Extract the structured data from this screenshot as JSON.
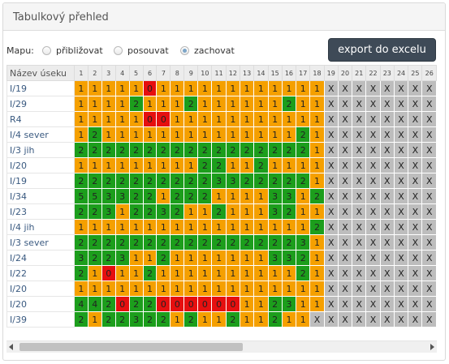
{
  "panel": {
    "title": "Tabulkový přehled"
  },
  "map": {
    "label": "Mapu:",
    "options": [
      {
        "label": "přibližovat",
        "selected": false
      },
      {
        "label": "posouvat",
        "selected": false
      },
      {
        "label": "zachovat",
        "selected": true
      }
    ]
  },
  "export_label": "export do excelu",
  "table": {
    "name_header": "Název úseku",
    "columns": [
      "1",
      "2",
      "3",
      "4",
      "5",
      "6",
      "7",
      "8",
      "9",
      "10",
      "11",
      "12",
      "13",
      "14",
      "15",
      "16",
      "17",
      "18",
      "19",
      "20",
      "21",
      "22",
      "23",
      "24",
      "25",
      "26"
    ],
    "rows": [
      {
        "name": "I/19",
        "cells": [
          "1",
          "1",
          "1",
          "1",
          "1",
          "0",
          "1",
          "1",
          "1",
          "1",
          "1",
          "1",
          "1",
          "1",
          "1",
          "1",
          "1",
          "1",
          "X",
          "X",
          "X",
          "X",
          "X",
          "X",
          "X",
          "X"
        ]
      },
      {
        "name": "I/29",
        "cells": [
          "1",
          "1",
          "1",
          "1",
          "2",
          "1",
          "1",
          "1",
          "2",
          "1",
          "1",
          "1",
          "1",
          "1",
          "1",
          "2",
          "1",
          "1",
          "X",
          "X",
          "X",
          "X",
          "X",
          "X",
          "X",
          "X"
        ]
      },
      {
        "name": "R4",
        "cells": [
          "1",
          "1",
          "1",
          "1",
          "1",
          "0",
          "0",
          "1",
          "1",
          "1",
          "1",
          "1",
          "1",
          "1",
          "1",
          "1",
          "1",
          "1",
          "X",
          "X",
          "X",
          "X",
          "X",
          "X",
          "X",
          "X"
        ]
      },
      {
        "name": "I/4 sever",
        "cells": [
          "1",
          "2",
          "1",
          "1",
          "1",
          "1",
          "1",
          "1",
          "1",
          "1",
          "1",
          "1",
          "1",
          "1",
          "1",
          "1",
          "2",
          "1",
          "X",
          "X",
          "X",
          "X",
          "X",
          "X",
          "X",
          "X"
        ]
      },
      {
        "name": "I/3 jih",
        "cells": [
          "2",
          "2",
          "2",
          "2",
          "2",
          "2",
          "2",
          "2",
          "2",
          "2",
          "2",
          "2",
          "2",
          "2",
          "2",
          "2",
          "2",
          "1",
          "X",
          "X",
          "X",
          "X",
          "X",
          "X",
          "X",
          "X"
        ]
      },
      {
        "name": "I/20",
        "cells": [
          "1",
          "1",
          "1",
          "1",
          "1",
          "1",
          "1",
          "1",
          "1",
          "2",
          "2",
          "1",
          "1",
          "2",
          "1",
          "1",
          "1",
          "1",
          "X",
          "X",
          "X",
          "X",
          "X",
          "X",
          "X",
          "X"
        ]
      },
      {
        "name": "I/19",
        "cells": [
          "2",
          "2",
          "2",
          "2",
          "2",
          "2",
          "2",
          "2",
          "2",
          "2",
          "3",
          "3",
          "2",
          "2",
          "2",
          "2",
          "2",
          "1",
          "X",
          "X",
          "X",
          "X",
          "X",
          "X",
          "X",
          "X"
        ]
      },
      {
        "name": "I/34",
        "cells": [
          "5",
          "5",
          "3",
          "3",
          "2",
          "2",
          "1",
          "2",
          "2",
          "2",
          "1",
          "1",
          "1",
          "1",
          "3",
          "3",
          "1",
          "2",
          "X",
          "X",
          "X",
          "X",
          "X",
          "X",
          "X",
          "X"
        ]
      },
      {
        "name": "I/23",
        "cells": [
          "2",
          "2",
          "3",
          "1",
          "2",
          "2",
          "3",
          "2",
          "1",
          "1",
          "2",
          "1",
          "1",
          "1",
          "3",
          "2",
          "1",
          "1",
          "X",
          "X",
          "X",
          "X",
          "X",
          "X",
          "X",
          "X"
        ]
      },
      {
        "name": "I/4 jih",
        "cells": [
          "1",
          "1",
          "1",
          "1",
          "1",
          "1",
          "1",
          "1",
          "1",
          "1",
          "1",
          "1",
          "1",
          "1",
          "1",
          "1",
          "1",
          "2",
          "X",
          "X",
          "X",
          "X",
          "X",
          "X",
          "X",
          "X"
        ]
      },
      {
        "name": "I/3 sever",
        "cells": [
          "2",
          "2",
          "2",
          "2",
          "2",
          "2",
          "2",
          "2",
          "2",
          "2",
          "2",
          "2",
          "2",
          "2",
          "2",
          "2",
          "3",
          "1",
          "X",
          "X",
          "X",
          "X",
          "X",
          "X",
          "X",
          "X"
        ]
      },
      {
        "name": "I/24",
        "cells": [
          "3",
          "2",
          "2",
          "3",
          "1",
          "1",
          "2",
          "1",
          "1",
          "1",
          "1",
          "1",
          "1",
          "1",
          "3",
          "3",
          "2",
          "1",
          "X",
          "X",
          "X",
          "X",
          "X",
          "X",
          "X",
          "X"
        ]
      },
      {
        "name": "I/22",
        "cells": [
          "2",
          "1",
          "0",
          "1",
          "1",
          "2",
          "1",
          "1",
          "1",
          "1",
          "1",
          "1",
          "1",
          "1",
          "1",
          "1",
          "2",
          "1",
          "X",
          "X",
          "X",
          "X",
          "X",
          "X",
          "X",
          "X"
        ]
      },
      {
        "name": "I/20",
        "cells": [
          "1",
          "1",
          "1",
          "1",
          "1",
          "1",
          "1",
          "1",
          "1",
          "1",
          "1",
          "1",
          "1",
          "1",
          "1",
          "1",
          "1",
          "1",
          "X",
          "X",
          "X",
          "X",
          "X",
          "X",
          "X",
          "X"
        ]
      },
      {
        "name": "I/20",
        "cells": [
          "4",
          "4",
          "2",
          "0",
          "2",
          "2",
          "0",
          "0",
          "0",
          "0",
          "0",
          "0",
          "1",
          "1",
          "2",
          "3",
          "1",
          "1",
          "X",
          "X",
          "X",
          "X",
          "X",
          "X",
          "X",
          "X"
        ]
      },
      {
        "name": "I/39",
        "cells": [
          "2",
          "1",
          "2",
          "2",
          "3",
          "2",
          "2",
          "1",
          "2",
          "1",
          "1",
          "2",
          "1",
          "1",
          "2",
          "1",
          "1",
          "X",
          "X",
          "X",
          "X",
          "X",
          "X",
          "X",
          "X",
          "X"
        ]
      }
    ]
  },
  "colors": {
    "level_0": "#e60f0f",
    "level_1": "#f5a000",
    "level_2_plus": "#1c9e1c",
    "no_data": "#bdbdbd",
    "export_button": "#3e4a57"
  }
}
